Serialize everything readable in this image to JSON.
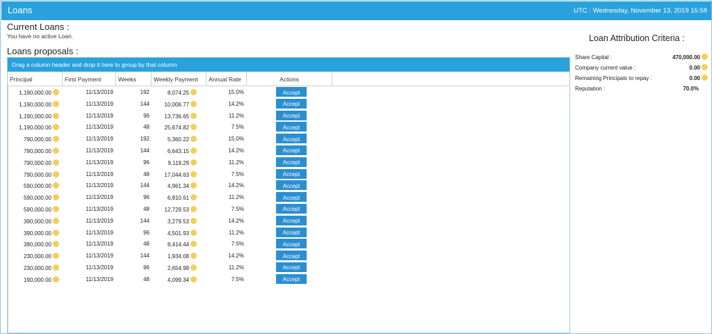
{
  "window": {
    "title": "Loans",
    "clock": "UTC : Wednesday, November 13, 2019 15:58"
  },
  "current_loans": {
    "heading": "Current Loans :",
    "message": "You have no active Loan."
  },
  "proposals": {
    "heading": "Loans proposals :",
    "group_hint": "Drag a column header and drop it here to group by that column",
    "columns": [
      "Principal",
      "First Payment",
      "Weeks",
      "Weekly Payment",
      "Annual Rate",
      "Actions"
    ],
    "accept_label": "Accept",
    "rows": [
      [
        "1,190,000.00",
        "11/13/2019",
        "192",
        "8,074.25",
        "15.0%"
      ],
      [
        "1,190,000.00",
        "11/13/2019",
        "144",
        "10,006.77",
        "14.2%"
      ],
      [
        "1,190,000.00",
        "11/13/2019",
        "96",
        "13,736.65",
        "11.2%"
      ],
      [
        "1,190,000.00",
        "11/13/2019",
        "48",
        "25,674.82",
        "7.5%"
      ],
      [
        "790,000.00",
        "11/13/2019",
        "192",
        "5,360.22",
        "15.0%"
      ],
      [
        "790,000.00",
        "11/13/2019",
        "144",
        "6,643.15",
        "14.2%"
      ],
      [
        "790,000.00",
        "11/13/2019",
        "96",
        "9,119.29",
        "11.2%"
      ],
      [
        "790,000.00",
        "11/13/2019",
        "48",
        "17,044.63",
        "7.5%"
      ],
      [
        "590,000.00",
        "11/13/2019",
        "144",
        "4,961.34",
        "14.2%"
      ],
      [
        "590,000.00",
        "11/13/2019",
        "96",
        "6,810.61",
        "11.2%"
      ],
      [
        "590,000.00",
        "11/13/2019",
        "48",
        "12,729.53",
        "7.5%"
      ],
      [
        "390,000.00",
        "11/13/2019",
        "144",
        "3,279.53",
        "14.2%"
      ],
      [
        "390,000.00",
        "11/13/2019",
        "96",
        "4,501.93",
        "11.2%"
      ],
      [
        "390,000.00",
        "11/13/2019",
        "48",
        "8,414.44",
        "7.5%"
      ],
      [
        "230,000.00",
        "11/13/2019",
        "144",
        "1,934.08",
        "14.2%"
      ],
      [
        "230,000.00",
        "11/13/2019",
        "96",
        "2,654.98",
        "11.2%"
      ],
      [
        "190,000.00",
        "11/13/2019",
        "48",
        "4,099.34",
        "7.5%"
      ]
    ]
  },
  "criteria": {
    "heading": "Loan Attribution Criteria :",
    "items": [
      {
        "label": "Share Capital :",
        "value": "470,000.00",
        "coin": true
      },
      {
        "label": "Company current value :",
        "value": "0.00",
        "coin": true
      },
      {
        "label": "Remaining Principals to repay :",
        "value": "0.00",
        "coin": true
      },
      {
        "label": "Reputation :",
        "value": "70.0%",
        "coin": false
      }
    ]
  },
  "colors": {
    "accent": "#29a1dc",
    "button": "#2b8fcf",
    "coin": "#f2cf5b"
  }
}
